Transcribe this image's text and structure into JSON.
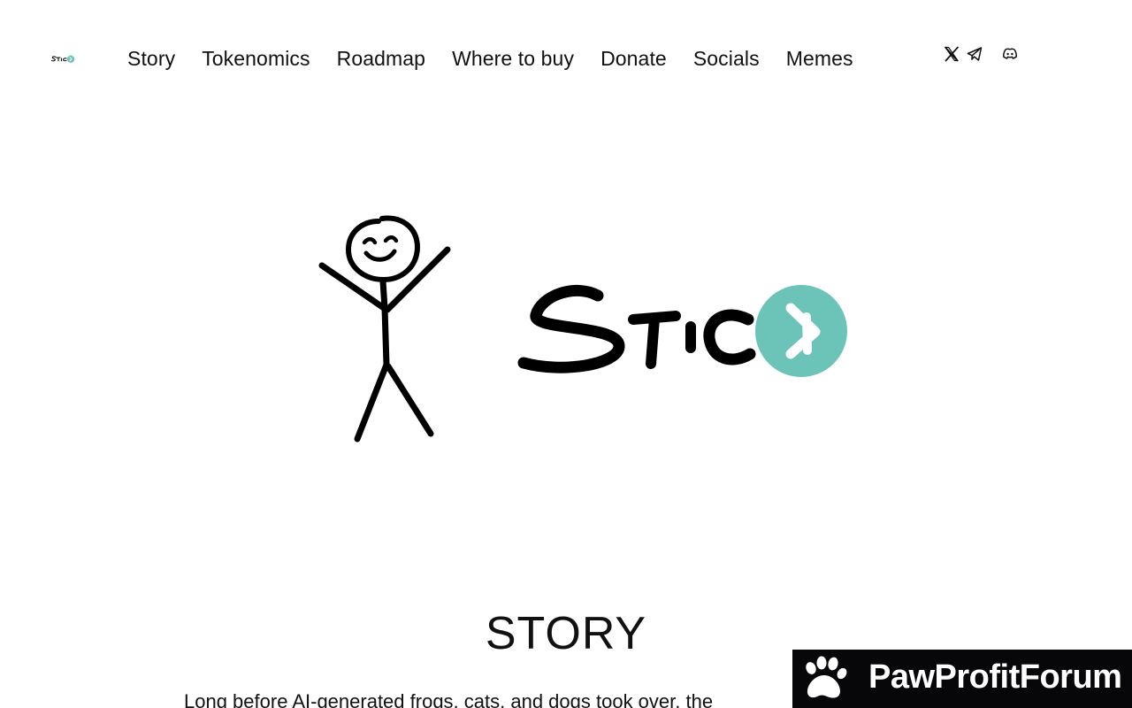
{
  "brand": {
    "name": "Stick",
    "accent_color": "#6cc4b8"
  },
  "nav": {
    "items": [
      {
        "label": "Story"
      },
      {
        "label": "Tokenomics"
      },
      {
        "label": "Roadmap"
      },
      {
        "label": "Where to buy"
      },
      {
        "label": "Donate"
      },
      {
        "label": "Socials"
      },
      {
        "label": "Memes"
      }
    ]
  },
  "socials": [
    {
      "icon": "x-icon"
    },
    {
      "icon": "telegram-icon"
    },
    {
      "icon": "discord-icon"
    }
  ],
  "story": {
    "heading": "STORY",
    "text": "Long before AI-generated frogs, cats, and dogs took over, the"
  },
  "watermark": {
    "text": "PawProfitForum",
    "icon": "paw-icon"
  }
}
